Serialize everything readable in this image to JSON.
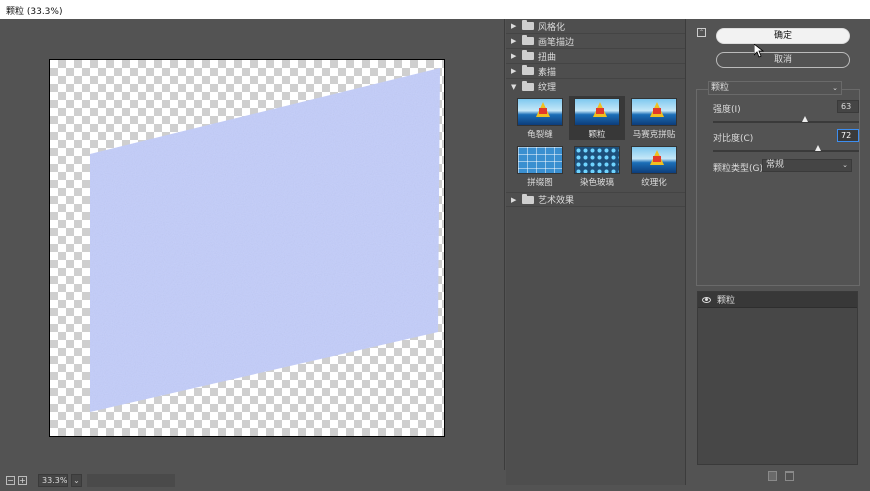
{
  "window": {
    "title": "颗粒 (33.3%)"
  },
  "zoom": {
    "value": "33.3%",
    "minus": "−",
    "plus": "+",
    "dropdown": "⌄"
  },
  "gallery": {
    "groups_top": [
      {
        "label": "风格化",
        "expanded": false
      },
      {
        "label": "画笔描边",
        "expanded": false
      },
      {
        "label": "扭曲",
        "expanded": false
      },
      {
        "label": "素描",
        "expanded": false
      }
    ],
    "open_group": {
      "label": "纹理",
      "expanded": true
    },
    "thumbnails": [
      {
        "label": "龟裂缝"
      },
      {
        "label": "颗粒",
        "selected": true
      },
      {
        "label": "马赛克拼贴"
      },
      {
        "label": "拼缀图"
      },
      {
        "label": "染色玻璃"
      },
      {
        "label": "纹理化"
      }
    ],
    "groups_bottom": [
      {
        "label": "艺术效果",
        "expanded": false
      }
    ],
    "arrow_collapsed": "▶",
    "arrow_expanded": "▼"
  },
  "panel": {
    "collapse_glyph": "⌃",
    "ok_label": "确定",
    "cancel_label": "取消",
    "filter_select": "颗粒",
    "chevron": "⌄",
    "intensity": {
      "label": "强度(I)",
      "value": "63",
      "fraction": 0.63
    },
    "contrast": {
      "label": "对比度(C)",
      "value": "72",
      "fraction": 0.72
    },
    "grain_type": {
      "label": "颗粒类型(G):",
      "value": "常规"
    },
    "layer": {
      "label": "颗粒"
    }
  },
  "colors": {
    "accent": "#3d8ef0",
    "shape_fill": "#c3cdfa"
  }
}
